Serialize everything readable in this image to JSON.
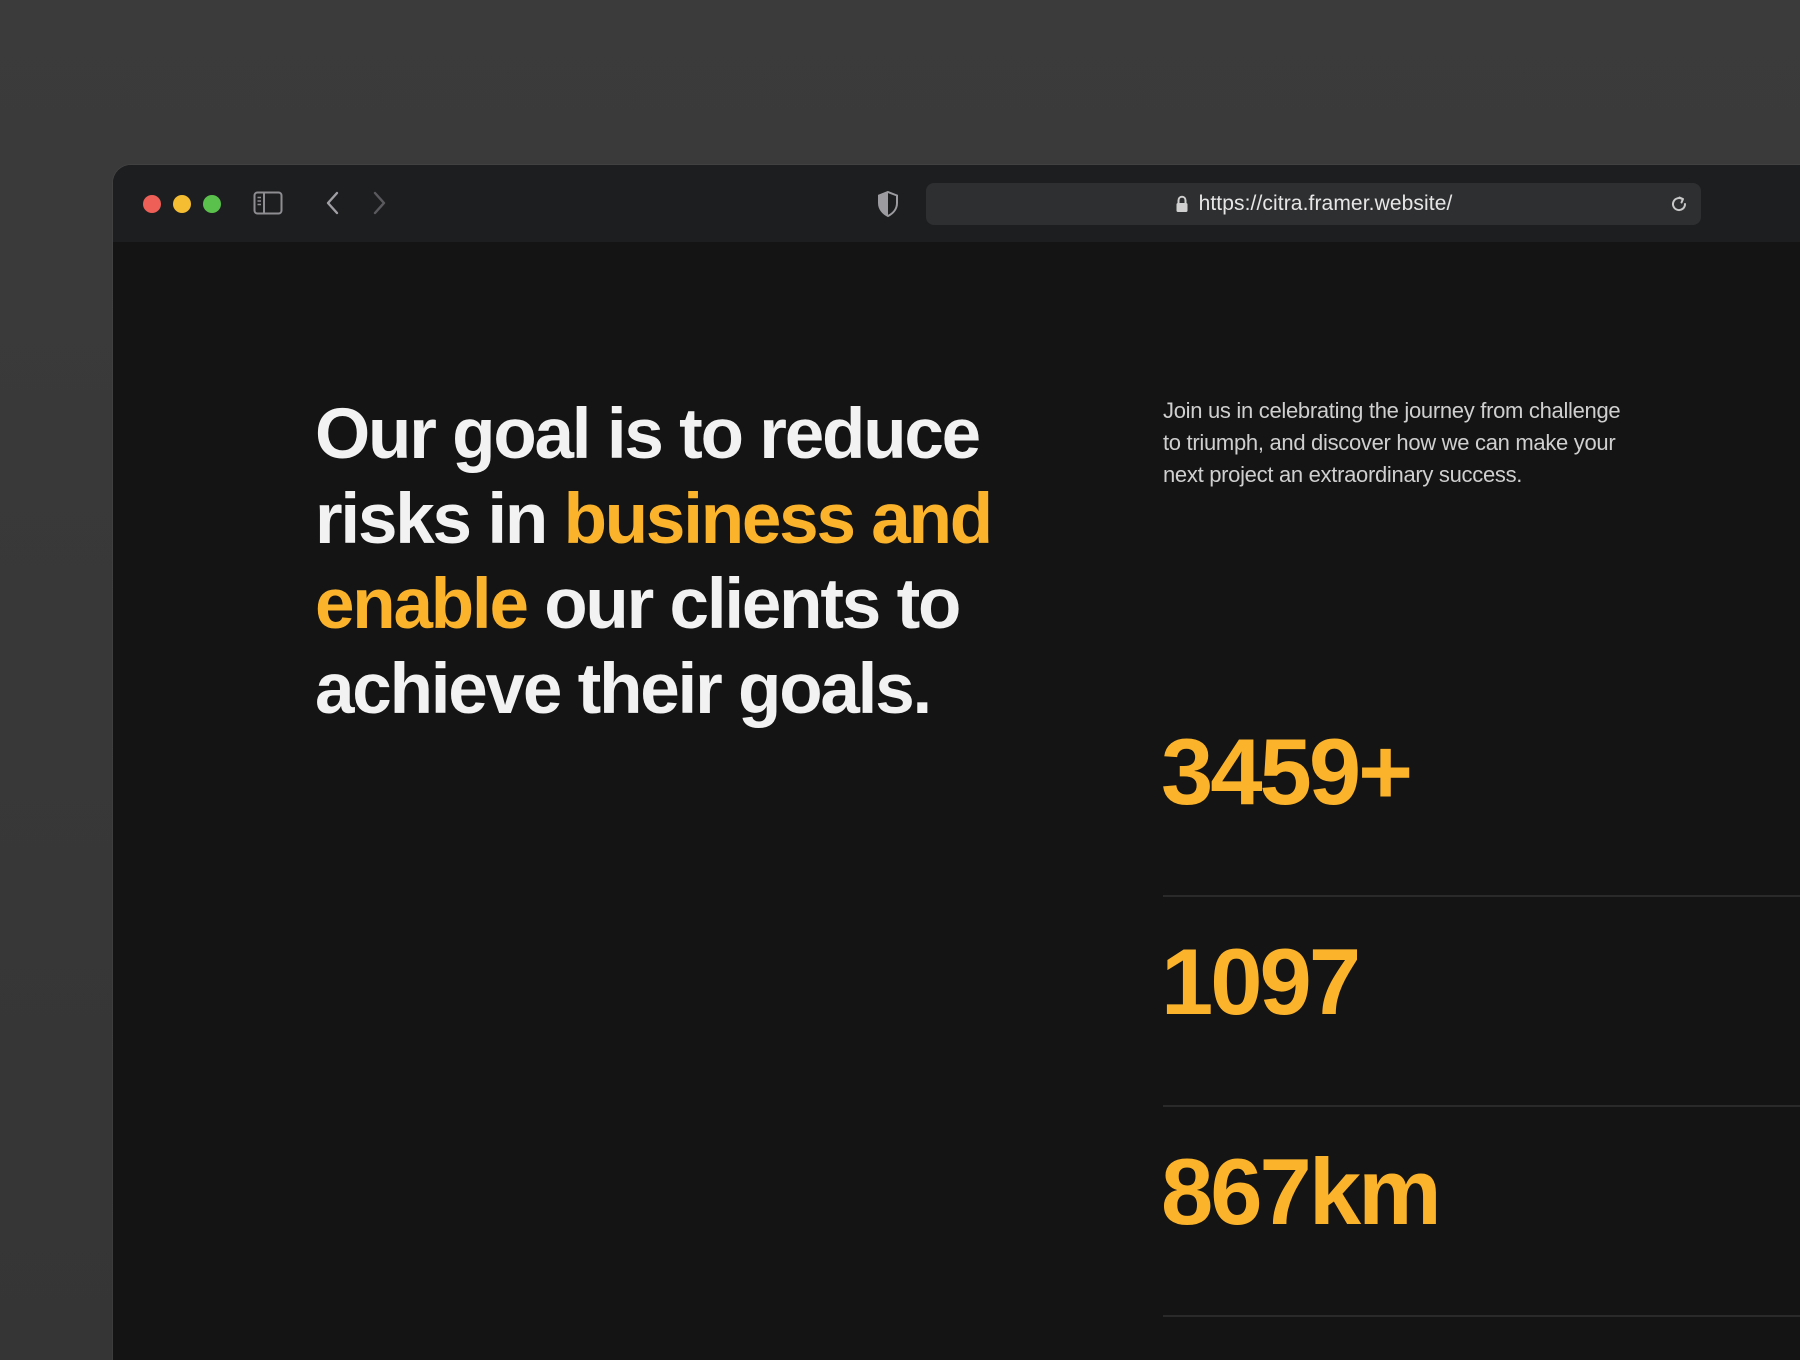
{
  "browser": {
    "url": "https://citra.framer.website/",
    "icons": {
      "sidebar": "sidebar-toggle-icon",
      "back": "chevron-left-icon",
      "forward": "chevron-right-icon",
      "shield": "shield-icon",
      "lock": "lock-icon",
      "reload": "reload-icon"
    },
    "colors": {
      "close": "#ee5f57",
      "minimize": "#f5bd31",
      "maximize": "#5ac14c"
    }
  },
  "hero": {
    "headline": {
      "part1": "Our goal is to reduce risks in ",
      "accent": "business and enable",
      "part2": " our clients to achieve their goals."
    },
    "blurb": "Join us in celebrating the journey from challenge to triumph, and discover how we can make your next project an extraordinary success.",
    "accent_color": "#fbb32c"
  },
  "stats": [
    {
      "value": "3459+"
    },
    {
      "value": "1097"
    },
    {
      "value": "867km"
    }
  ]
}
